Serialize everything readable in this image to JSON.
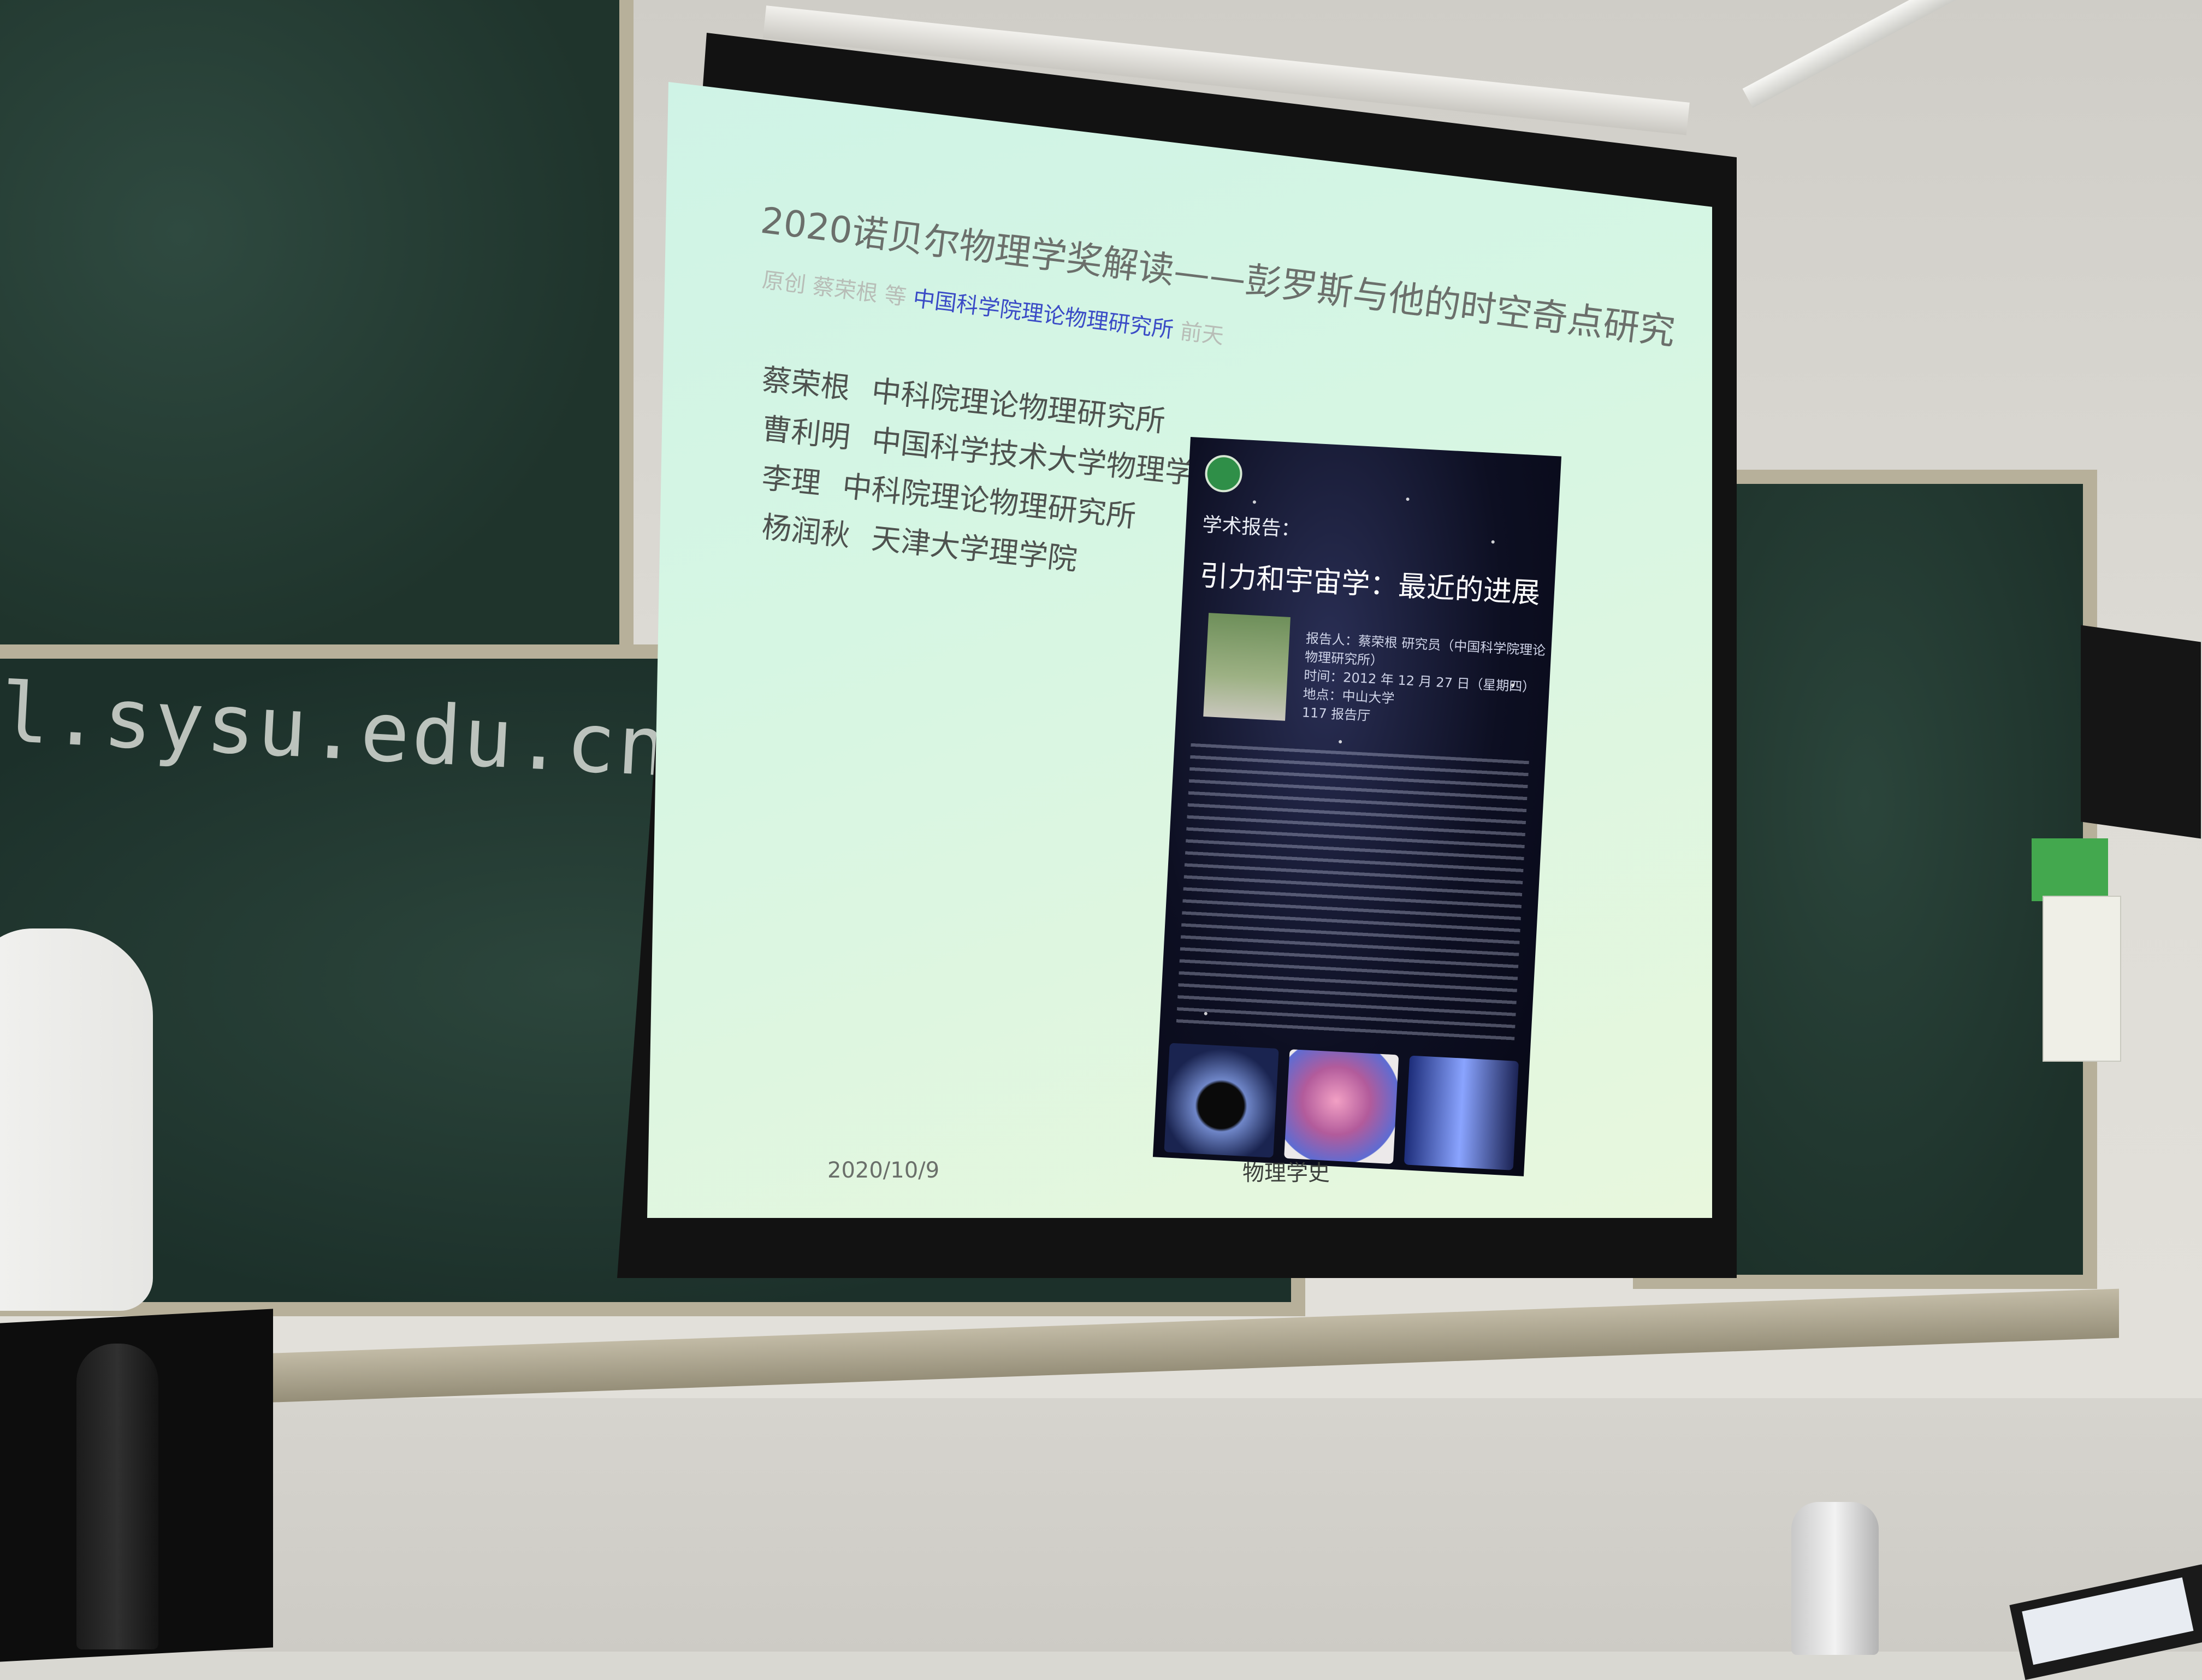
{
  "board": {
    "chalk_text": "l.sysu.edu.cn"
  },
  "slide": {
    "title": "2020诺贝尔物理学奖解读——彭罗斯与他的时空奇点研究",
    "byline_prefix": "原创  蔡荣根 等  ",
    "byline_institution": "中国科学院理论物理研究所",
    "byline_suffix": "  前天",
    "authors": [
      {
        "name": "蔡荣根",
        "affiliation": "中科院理论物理研究所"
      },
      {
        "name": "曹利明",
        "affiliation": "中国科学技术大学物理学院"
      },
      {
        "name": "李理",
        "affiliation": "中科院理论物理研究所"
      },
      {
        "name": "杨润秋",
        "affiliation": "天津大学理学院"
      }
    ],
    "date": "2020/10/9",
    "footer": "物理学史",
    "poster": {
      "label": "学术报告：",
      "title": "引力和宇宙学：最近的进展",
      "details": [
        "报告人：蔡荣根 研究员（中国科学院理论物理研究所）",
        "时间：2012 年 12 月 27 日（星期四）",
        "地点：中山大学",
        "117 报告厅"
      ]
    }
  }
}
